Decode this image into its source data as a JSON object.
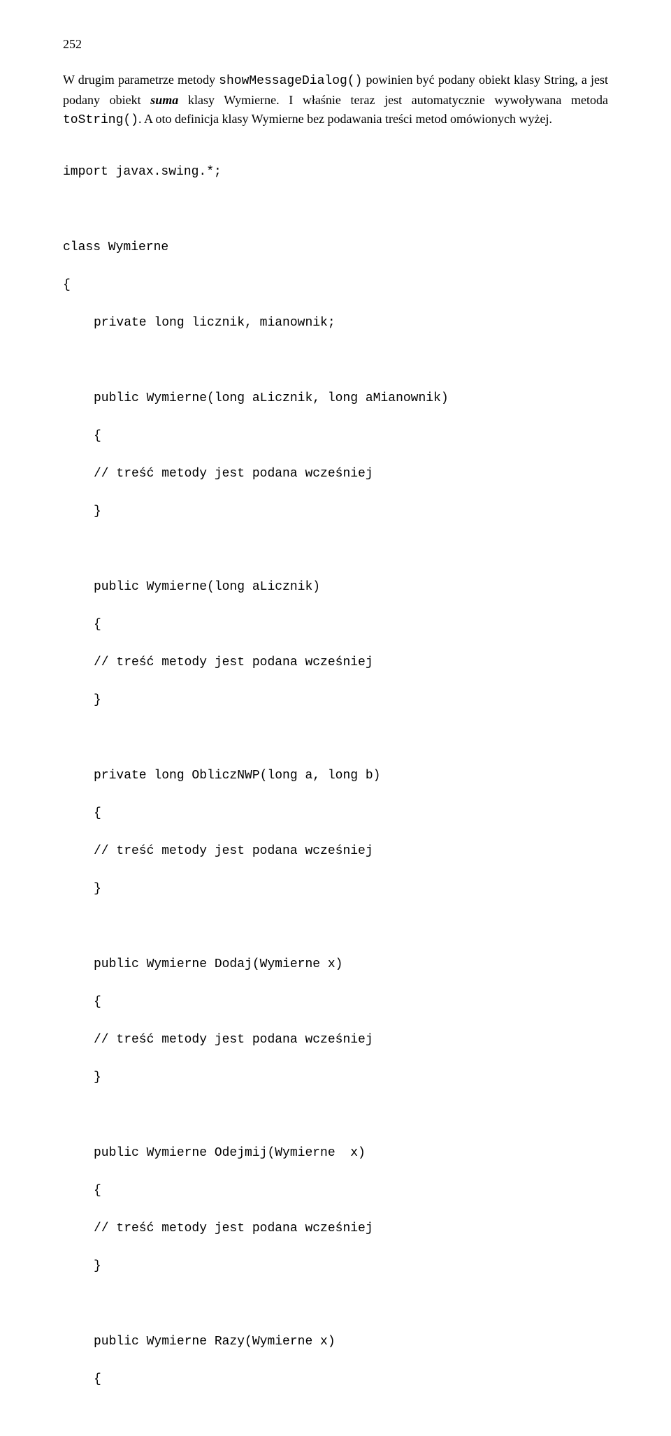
{
  "page_number": "252",
  "para": {
    "t1": "W drugim parametrze metody ",
    "tt1": "showMessageDialog()",
    "t2": " powinien być podany obiekt klasy String, a jest podany obiekt ",
    "ib1": "suma",
    "t3": " klasy Wymierne. I właśnie teraz jest automatycznie wywoływana metoda ",
    "tt2": "toString()",
    "t4": ". A oto definicja klasy Wymierne bez podawania treści metod omówionych wyżej."
  },
  "code": {
    "l1": "import javax.swing.*;",
    "l2": "class Wymierne",
    "l3": "{",
    "l4": "private long licznik, mianownik;",
    "l5": "public Wymierne(long aLicznik, long aMianownik)",
    "l6": "{",
    "l7": "// treść metody jest podana wcześniej",
    "l8": "}",
    "l9": "public Wymierne(long aLicznik)",
    "l10": "{",
    "l11": "// treść metody jest podana wcześniej",
    "l12": "}",
    "l13": "private long ObliczNWP(long a, long b)",
    "l14": "{",
    "l15": "// treść metody jest podana wcześniej",
    "l16": "}",
    "l17": "public Wymierne Dodaj(Wymierne x)",
    "l18": "{",
    "l19": "// treść metody jest podana wcześniej",
    "l20": "}",
    "l21": "public Wymierne Odejmij(Wymierne  x)",
    "l22": "{",
    "l23": "// treść metody jest podana wcześniej",
    "l24": "}",
    "l25": "public Wymierne Razy(Wymierne x)",
    "l26": "{"
  }
}
